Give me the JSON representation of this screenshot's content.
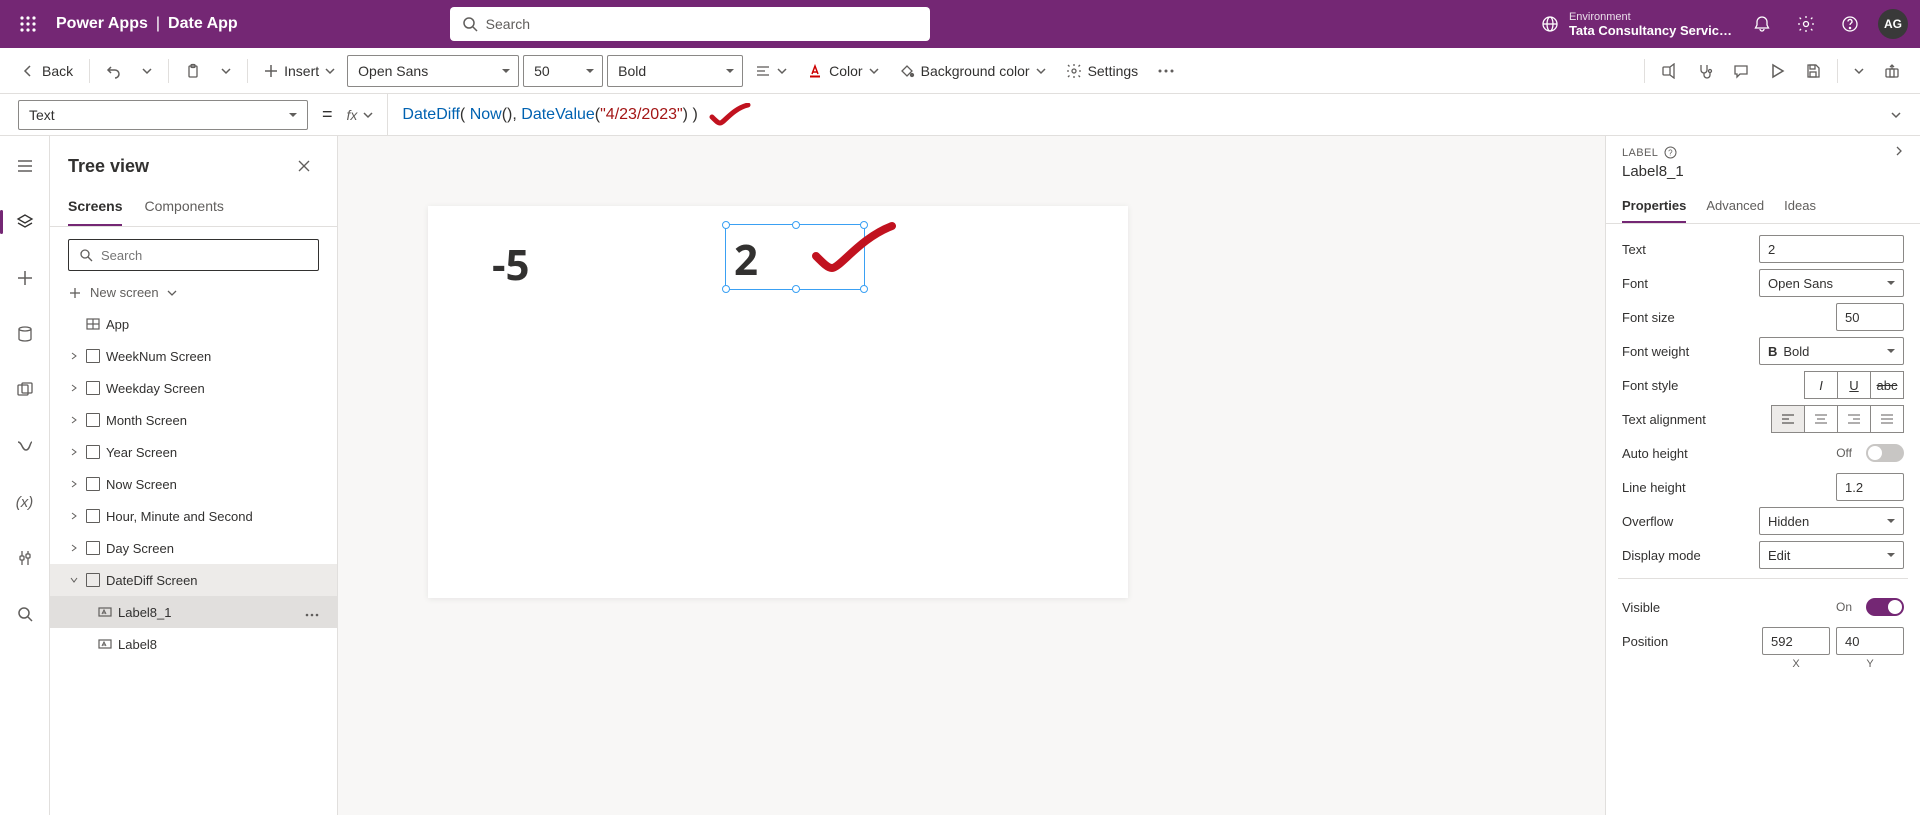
{
  "header": {
    "brand": "Power Apps",
    "app_name": "Date App",
    "search_placeholder": "Search",
    "environment_label": "Environment",
    "environment_name": "Tata Consultancy Servic…",
    "avatar_initials": "AG"
  },
  "toolbar": {
    "back": "Back",
    "insert": "Insert",
    "font_family": "Open Sans",
    "font_size": "50",
    "font_weight": "Bold",
    "color": "Color",
    "background_color": "Background color",
    "settings": "Settings"
  },
  "formula": {
    "property": "Text",
    "fx": "fx",
    "eq": "=",
    "tokens": {
      "f1": "DateDiff",
      "p1": "( ",
      "f2": "Now",
      "p2": "()",
      "c1": ", ",
      "f3": "DateValue",
      "p3": "(",
      "s1": "\"4/23/2023\"",
      "p4": ")",
      "p5": " )"
    }
  },
  "tree": {
    "title": "Tree view",
    "tab_screens": "Screens",
    "tab_components": "Components",
    "search_placeholder": "Search",
    "new_screen": "New screen",
    "app": "App",
    "items": [
      "WeekNum Screen",
      "Weekday Screen",
      "Month Screen",
      "Year Screen",
      "Now Screen",
      "Hour, Minute and Second",
      "Day Screen",
      "DateDiff Screen"
    ],
    "child1": "Label8_1",
    "child2": "Label8"
  },
  "canvas": {
    "label_a": "-5",
    "label_b": "2"
  },
  "props": {
    "type": "LABEL",
    "name": "Label8_1",
    "tab_properties": "Properties",
    "tab_advanced": "Advanced",
    "tab_ideas": "Ideas",
    "text_lbl": "Text",
    "text_val": "2",
    "font_lbl": "Font",
    "font_val": "Open Sans",
    "fontsize_lbl": "Font size",
    "fontsize_val": "50",
    "fontweight_lbl": "Font weight",
    "fontweight_val": "Bold",
    "fontstyle_lbl": "Font style",
    "textalign_lbl": "Text alignment",
    "autoheight_lbl": "Auto height",
    "autoheight_state": "Off",
    "lineheight_lbl": "Line height",
    "lineheight_val": "1.2",
    "overflow_lbl": "Overflow",
    "overflow_val": "Hidden",
    "displaymode_lbl": "Display mode",
    "displaymode_val": "Edit",
    "visible_lbl": "Visible",
    "visible_state": "On",
    "position_lbl": "Position",
    "pos_x": "592",
    "pos_y": "40",
    "axis_x": "X",
    "axis_y": "Y"
  }
}
